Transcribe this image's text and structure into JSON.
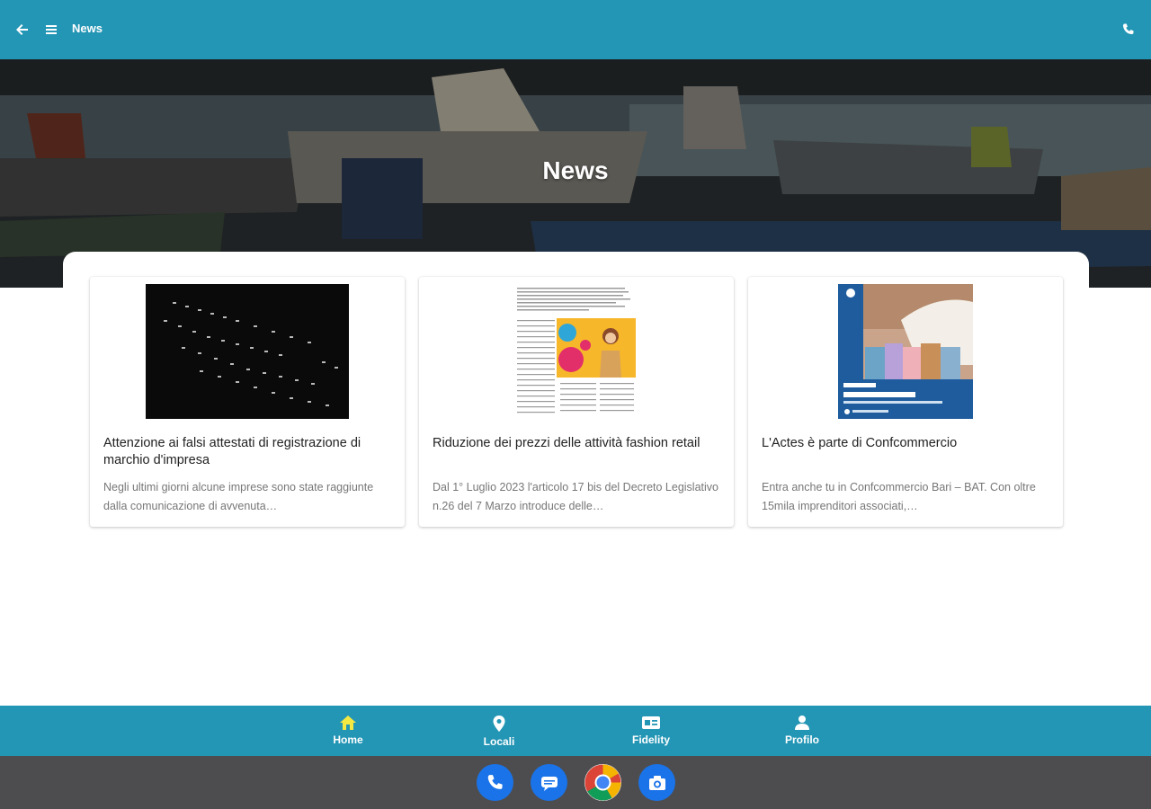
{
  "app_bar": {
    "title": "News",
    "icons": [
      "back-arrow-icon",
      "menu-icon",
      "phone-icon"
    ],
    "background": "#2496b5"
  },
  "hero": {
    "title": "News"
  },
  "news": [
    {
      "title": "Attenzione ai falsi attestati di registrazione di marchio d'impresa",
      "excerpt": "Negli ultimi giorni alcune imprese sono state raggiunte dalla comunicazione di avvenuta…",
      "thumbnail": "keyboard-photo"
    },
    {
      "title": "Riduzione dei prezzi delle attività fashion retail",
      "excerpt": "Dal 1° Luglio 2023 l'articolo 17 bis del Decreto Legislativo n.26 del 7 Marzo introduce delle…",
      "thumbnail": "newspaper-sale-clipping"
    },
    {
      "title": "L'Actes è parte di Confcommercio",
      "excerpt": "Entra anche tu in Confcommercio Bari – BAT. Con oltre 15mila imprenditori associati,…",
      "thumbnail": "shopping-bags-poster"
    }
  ],
  "bottom_nav": [
    {
      "label": "Home",
      "icon": "home-icon",
      "active": true
    },
    {
      "label": "Locali",
      "icon": "location-pin-icon",
      "active": false
    },
    {
      "label": "Fidelity",
      "icon": "id-card-icon",
      "active": false
    },
    {
      "label": "Profilo",
      "icon": "user-icon",
      "active": false
    }
  ],
  "dock": [
    "phone-app-icon",
    "messages-app-icon",
    "chrome-app-icon",
    "camera-app-icon"
  ],
  "colors": {
    "accent": "#2496b5",
    "active_nav": "#f4e842",
    "dock_bg": "#4d4d4f"
  }
}
